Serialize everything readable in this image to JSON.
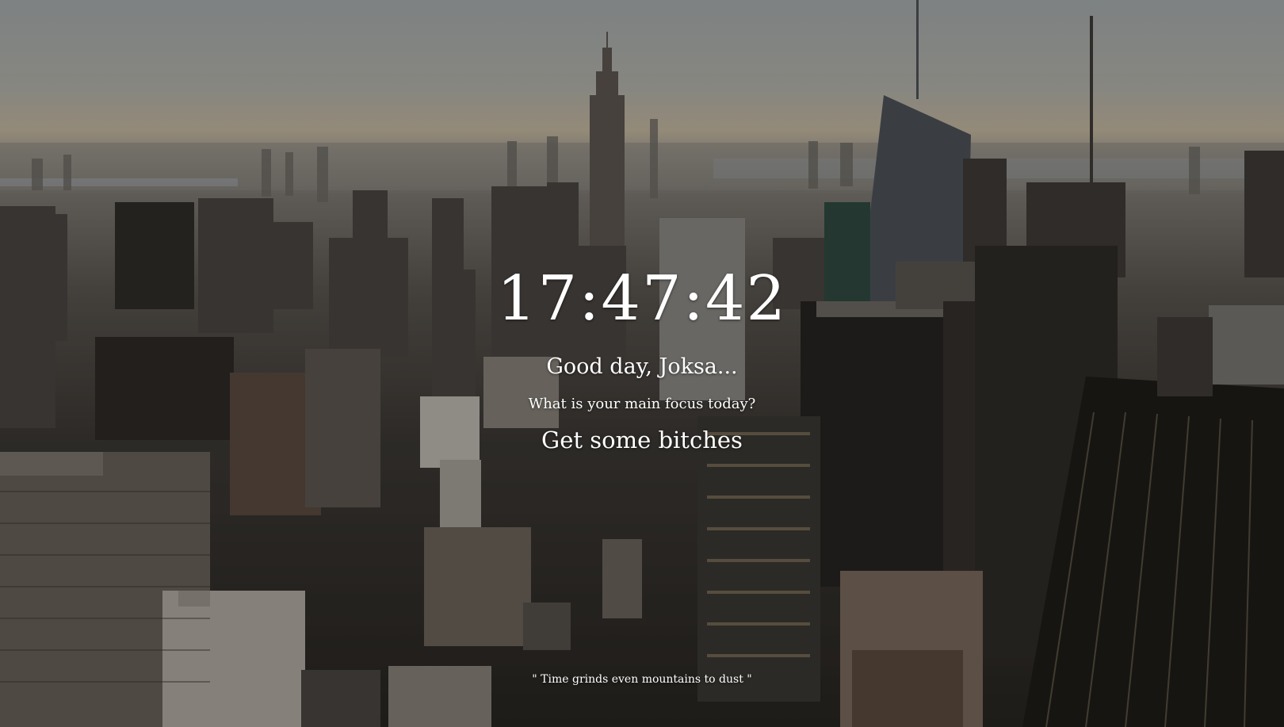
{
  "clock": {
    "time": "17:47:42"
  },
  "greeting": {
    "text": "Good day, Joksa..."
  },
  "focus": {
    "question": "What is your main focus today?",
    "answer": "Get some bitches"
  },
  "quote": {
    "text": "\" Time grinds even mountains to dust \""
  },
  "theme": {
    "text_color": "#ffffff",
    "overlay_color": "#0a0a0c"
  }
}
